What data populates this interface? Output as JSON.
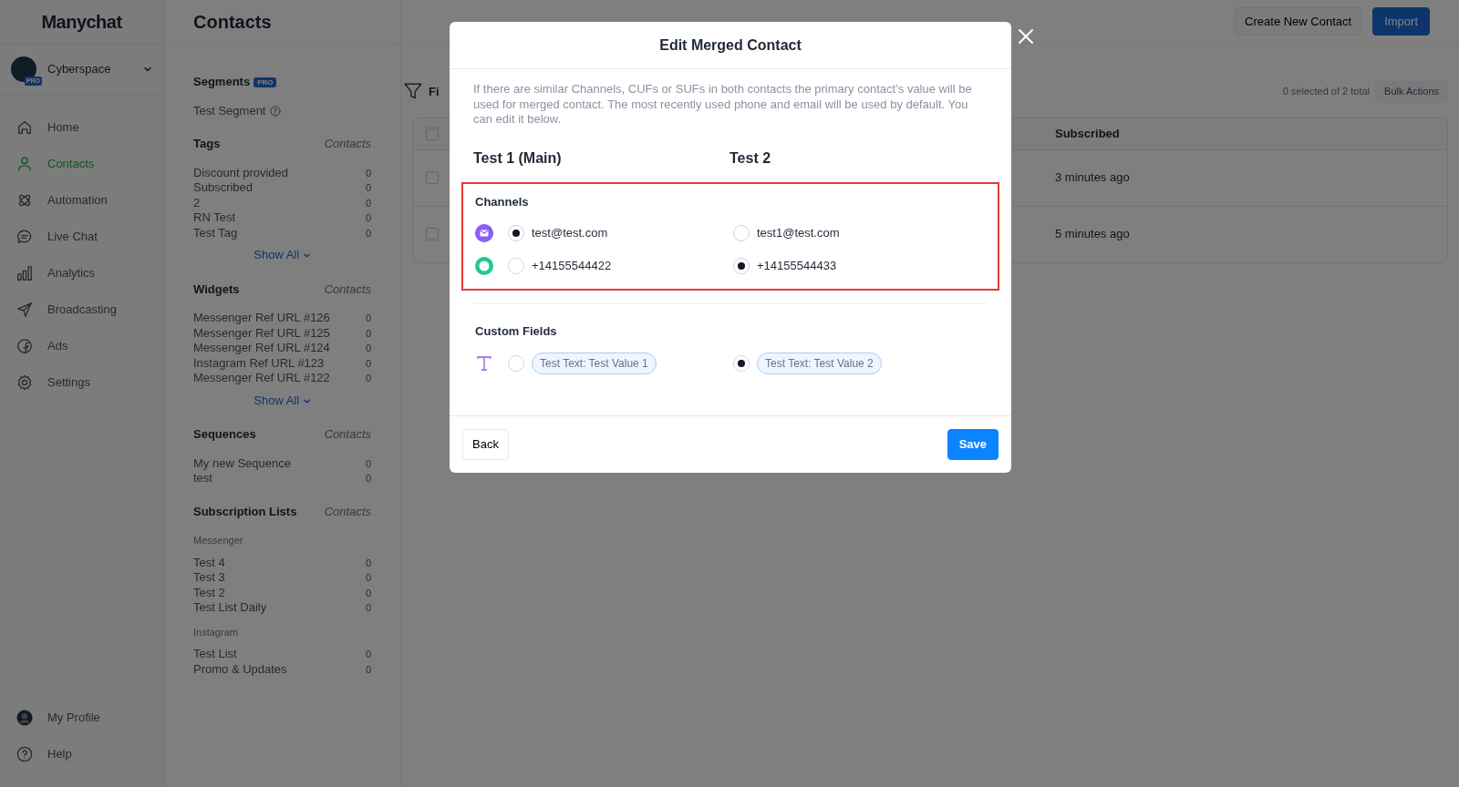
{
  "sidebar": {
    "logo": "Manychat",
    "account": {
      "name": "Cyberspace",
      "badge": "PRO"
    },
    "items": [
      {
        "label": "Home",
        "selected": false
      },
      {
        "label": "Contacts",
        "selected": true
      },
      {
        "label": "Automation",
        "selected": false
      },
      {
        "label": "Live Chat",
        "selected": false
      },
      {
        "label": "Analytics",
        "selected": false
      },
      {
        "label": "Broadcasting",
        "selected": false
      },
      {
        "label": "Ads",
        "selected": false
      },
      {
        "label": "Settings",
        "selected": false
      }
    ],
    "bottom": [
      {
        "kind": "profile",
        "label": "My Profile"
      },
      {
        "kind": "help",
        "label": "Help"
      }
    ]
  },
  "header": {
    "title": "Contacts",
    "buttons": [
      {
        "label": "Create New Contact",
        "kind": "secondary"
      },
      {
        "label": "Import",
        "kind": "primary"
      }
    ]
  },
  "segments": {
    "title": "Segments",
    "badge": "PRO",
    "items": [
      "Test Segment"
    ]
  },
  "sections": [
    {
      "title": "Tags",
      "column": "Contacts",
      "groups": [
        {
          "items": [
            {
              "name": "Discount provided",
              "count": "0"
            },
            {
              "name": "Subscribed",
              "count": "0"
            },
            {
              "name": "2",
              "count": "0"
            },
            {
              "name": "RN Test",
              "count": "0"
            },
            {
              "name": "Test Tag",
              "count": "0"
            }
          ]
        }
      ],
      "show_all": "Show All"
    },
    {
      "title": "Widgets",
      "column": "Contacts",
      "groups": [
        {
          "items": [
            {
              "name": "Messenger Ref URL #126",
              "count": "0"
            },
            {
              "name": "Messenger Ref URL #125",
              "count": "0"
            },
            {
              "name": "Messenger Ref URL #124",
              "count": "0"
            },
            {
              "name": "Instagram Ref URL #123",
              "count": "0"
            },
            {
              "name": "Messenger Ref URL #122",
              "count": "0"
            }
          ]
        }
      ],
      "show_all": "Show All"
    },
    {
      "title": "Sequences",
      "column": "Contacts",
      "groups": [
        {
          "items": [
            {
              "name": "My new Sequence",
              "count": "0"
            },
            {
              "name": "test",
              "count": "0"
            }
          ]
        }
      ]
    },
    {
      "title": "Subscription Lists",
      "column": "Contacts",
      "groups": [
        {
          "label": "Messenger",
          "items": [
            {
              "name": "Test 4",
              "count": "0"
            },
            {
              "name": "Test 3",
              "count": "0"
            },
            {
              "name": "Test 2",
              "count": "0"
            },
            {
              "name": "Test List Daily",
              "count": "0"
            }
          ]
        },
        {
          "label": "Instagram",
          "items": [
            {
              "name": "Test List",
              "count": "0"
            },
            {
              "name": "Promo & Updates",
              "count": "0"
            }
          ]
        }
      ]
    }
  ],
  "toolbar": {
    "filter": "Fi",
    "selection": "0 selected of 2 total",
    "bulk": "Bulk Actions"
  },
  "table": {
    "all_checked": false,
    "columns": [
      "Subscribed"
    ],
    "rows": [
      {
        "checked": false,
        "subscribed": "3 minutes ago"
      },
      {
        "checked": false,
        "subscribed": "5 minutes ago"
      }
    ]
  },
  "modal": {
    "title": "Edit Merged Contact",
    "description": "If there are similar Channels, CUFs or SUFs in both contacts the primary contact’s value will be used for merged contact. The most recently used phone and email will be used by default. You can edit it below.",
    "contacts": [
      "Test 1 (Main)",
      "Test 2"
    ],
    "sections": [
      {
        "title": "Channels",
        "highlighted": true,
        "rows": [
          {
            "kind": "email",
            "options": [
              {
                "text": "test@test.com",
                "selected": true
              },
              {
                "text": "test1@test.com",
                "selected": false
              }
            ]
          },
          {
            "kind": "phone",
            "options": [
              {
                "text": "+14155544422",
                "selected": false
              },
              {
                "text": "+14155544433",
                "selected": true
              }
            ]
          }
        ]
      },
      {
        "title": "Custom Fields",
        "highlighted": false,
        "rows": [
          {
            "kind": "text",
            "options": [
              {
                "text": "Test Text: Test Value 1",
                "selected": false
              },
              {
                "text": "Test Text: Test Value 2",
                "selected": true
              }
            ]
          }
        ]
      }
    ],
    "buttons": [
      {
        "label": "Back",
        "kind": "secondary"
      },
      {
        "label": "Save",
        "kind": "primary"
      }
    ]
  }
}
